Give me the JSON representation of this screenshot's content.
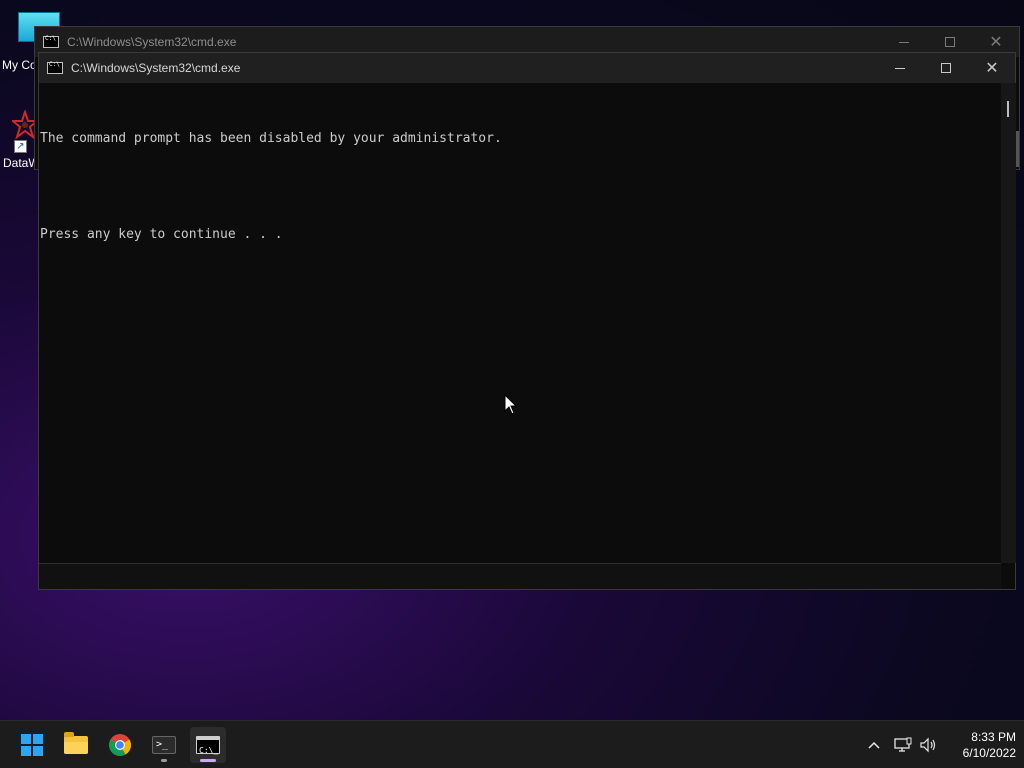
{
  "desktop": {
    "icons": [
      {
        "label": "My Co"
      },
      {
        "label": "DataW"
      }
    ]
  },
  "back_window": {
    "title": "C:\\Windows\\System32\\cmd.exe"
  },
  "front_window": {
    "title": "C:\\Windows\\System32\\cmd.exe",
    "console_lines": [
      "The command prompt has been disabled by your administrator.",
      "Press any key to continue . . ."
    ]
  },
  "taskbar": {
    "apps": [
      {
        "name": "start-button",
        "icon": "windows-logo-icon"
      },
      {
        "name": "file-explorer",
        "icon": "folder-icon"
      },
      {
        "name": "chrome",
        "icon": "chrome-icon"
      },
      {
        "name": "terminal",
        "icon": "terminal-icon"
      },
      {
        "name": "cmd",
        "icon": "cmd-icon",
        "active": true
      }
    ],
    "tray": {
      "icons": [
        "chevron-up-icon",
        "network-icon",
        "volume-icon"
      ]
    },
    "clock": {
      "time": "8:33 PM",
      "date": "6/10/2022"
    }
  },
  "colors": {
    "console_bg": "#0c0c0c",
    "console_text": "#cccccc",
    "titlebar": "#202020",
    "taskbar": "#1c1c1c",
    "start_blue": "#2aa6f5",
    "active_underline": "#c9a9ff"
  }
}
